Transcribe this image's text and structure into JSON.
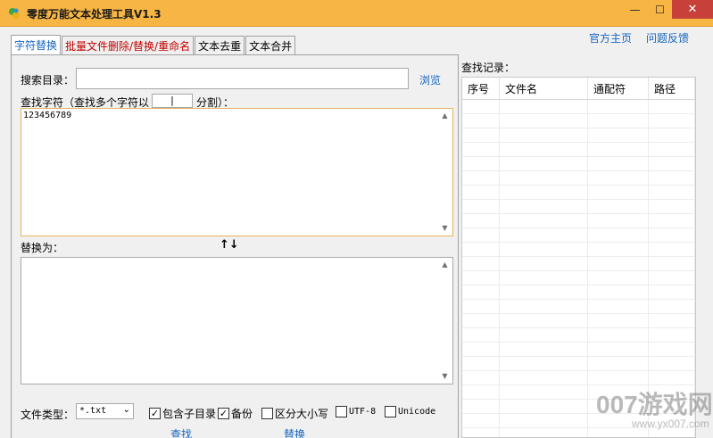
{
  "window": {
    "title": "零度万能文本处理工具V1.3",
    "minimize": "—",
    "maximize": "☐",
    "close": "✕"
  },
  "tabs": [
    {
      "label": "字符替换"
    },
    {
      "label": "批量文件删除/替换/重命名"
    },
    {
      "label": "文本去重"
    },
    {
      "label": "文本合并"
    }
  ],
  "links": {
    "homepage": "官方主页",
    "feedback": "问题反馈"
  },
  "form": {
    "search_dir_label": "搜索目录：",
    "search_dir_value": "",
    "browse": "浏览",
    "find_label_prefix": "查找字符（查找多个字符以",
    "separator_value": "|",
    "find_label_suffix": "分割）：",
    "find_text": "123456789",
    "replace_label": "替换为：",
    "swap": "↑↓",
    "replace_text": "",
    "file_type_label": "文件类型：",
    "file_type_value": "*.txt",
    "options": {
      "subdir": {
        "label": "包含子目录",
        "checked": true
      },
      "backup": {
        "label": "备份",
        "checked": true
      },
      "case": {
        "label": "区分大小写",
        "checked": false
      },
      "utf8": {
        "label": "UTF-8",
        "checked": false
      },
      "unicode": {
        "label": "Unicode",
        "checked": false
      }
    },
    "find_button": "查找",
    "replace_button": "替换"
  },
  "records": {
    "label": "查找记录：",
    "columns": [
      "序号",
      "文件名",
      "通配符",
      "路径"
    ],
    "rows": []
  },
  "watermark": {
    "big": "007游戏网",
    "small": "www.yx007.com"
  },
  "colors": {
    "titlebar": "#f7b544",
    "link": "#1565c0",
    "tab_red": "#c00000",
    "close": "#c7403a"
  }
}
